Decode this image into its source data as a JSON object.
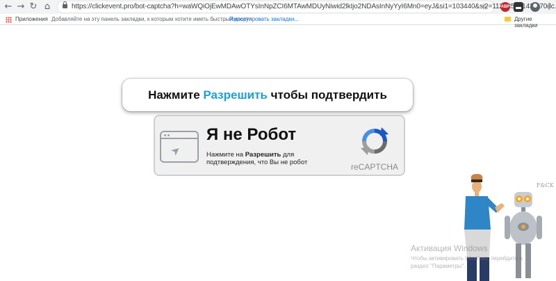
{
  "browser": {
    "url": "https://clickevent.pro/bot-captcha?h=waWQiOjEwMDAwOTYsInNpZCI6MTAwMDUyNiwid2lkIjo2NDAsInNyYyI6Mn0=eyJ&si1=103440&si2=112585_4143-470dc...",
    "icons": [
      "back-icon",
      "forward-icon",
      "reload-icon",
      "home-icon",
      "lock-icon",
      "star-icon",
      "adblock-icon",
      "extension-icon",
      "profile-icon",
      "menu-icon"
    ],
    "adblock_label": "ABP"
  },
  "bookmarks": {
    "apps_label": "Приложения",
    "hint": "Добавляйте на эту панель закладки, к которым хотите иметь быстрый доступ.",
    "import_link": "Импортировать закладки...",
    "other_label": "Другие закладки"
  },
  "page": {
    "headline_pre": "Нажмите",
    "headline_accent": "Разрешить",
    "headline_post": "чтобы подтвердить",
    "accent_color": "#1aa0d8",
    "captcha": {
      "title": "Я не Робот",
      "desc_pre": "Нажмите на",
      "desc_bold": "Разрешить",
      "desc_post": "для подтверждения, что Вы не робот",
      "brand": "reCAPTCHA"
    },
    "illustration_label": "F&CK"
  },
  "watermark": {
    "title": "Активация Windows",
    "line1": "Чтобы активировать Windows, перейдите в",
    "line2": "раздел \"Параметры\"."
  }
}
